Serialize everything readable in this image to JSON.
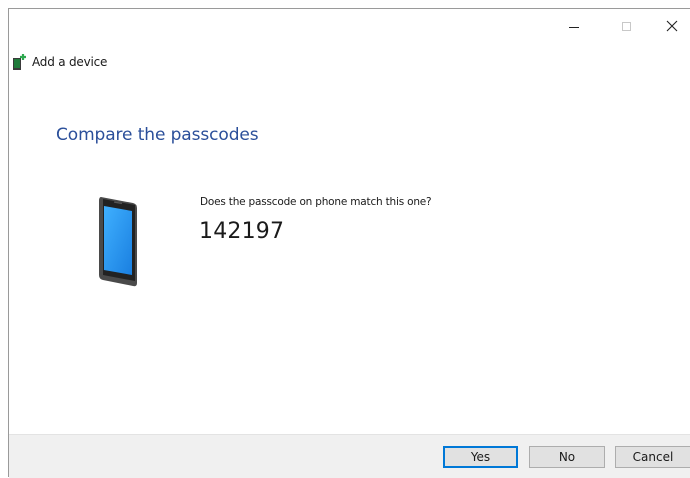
{
  "window": {
    "title": "Add a device",
    "controls": {
      "minimize": "minimize-icon",
      "maximize": "maximize-icon",
      "close": "close-icon"
    }
  },
  "content": {
    "heading": "Compare the passcodes",
    "question": "Does the passcode on phone match this one?",
    "passcode": "142197",
    "device_icon": "phone-icon"
  },
  "buttons": {
    "yes": "Yes",
    "no": "No",
    "cancel": "Cancel"
  },
  "colors": {
    "heading": "#2b4f9a",
    "default_button_border": "#0078d7",
    "footer_background": "#f0f0f0"
  }
}
